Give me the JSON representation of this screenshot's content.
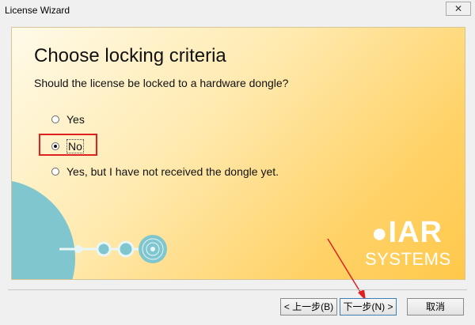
{
  "window": {
    "title": "License Wizard",
    "close_glyph": "✕"
  },
  "page": {
    "heading": "Choose locking criteria",
    "question": "Should the license be locked to a hardware dongle?",
    "options": [
      {
        "label": "Yes",
        "selected": false
      },
      {
        "label": "No",
        "selected": true
      },
      {
        "label": "Yes, but I have not received the dongle yet.",
        "selected": false
      }
    ]
  },
  "logo": {
    "line1": "IAR",
    "line2": "SYSTEMS"
  },
  "buttons": {
    "back": "< 上一步(B)",
    "next": "下一步(N) >",
    "cancel": "取消"
  },
  "colors": {
    "highlight": "#e02020",
    "accent_teal": "#7fc6cf"
  }
}
